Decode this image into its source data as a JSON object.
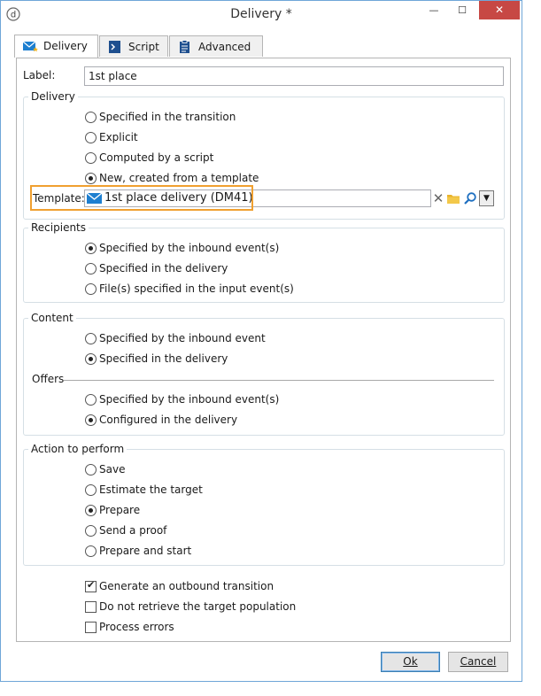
{
  "window": {
    "title": "Delivery *",
    "minimize": "—",
    "maximize": "☐",
    "close": "✕"
  },
  "tabs": [
    {
      "label": "Delivery",
      "icon": "envelope-star-icon"
    },
    {
      "label": "Script",
      "icon": "script-icon"
    },
    {
      "label": "Advanced",
      "icon": "clipboard-icon"
    }
  ],
  "label_field": {
    "label": "Label:",
    "value": "1st place"
  },
  "delivery_group": {
    "title": "Delivery",
    "options": [
      "Specified in the transition",
      "Explicit",
      "Computed by a script",
      "New, created from a template"
    ],
    "selected": 3
  },
  "template_field": {
    "label": "Template:",
    "value": "1st place delivery (DM41)",
    "icon": "envelope-icon"
  },
  "recipients_group": {
    "title": "Recipients",
    "options": [
      "Specified by the inbound event(s)",
      "Specified in the delivery",
      "File(s) specified in the input event(s)"
    ],
    "selected": 0
  },
  "content_group": {
    "title": "Content",
    "options": [
      "Specified by the inbound event",
      "Specified in the delivery"
    ],
    "selected": 1,
    "offers_title": "Offers",
    "offers_options": [
      "Specified by the inbound event(s)",
      "Configured in the delivery"
    ],
    "offers_selected": 1
  },
  "action_group": {
    "title": "Action to perform",
    "options": [
      "Save",
      "Estimate the target",
      "Prepare",
      "Send a proof",
      "Prepare and start"
    ],
    "selected": 2
  },
  "checkboxes": [
    {
      "label": "Generate an outbound transition",
      "checked": true
    },
    {
      "label": "Do not retrieve the target population",
      "checked": false
    },
    {
      "label": "Process errors",
      "checked": false
    }
  ],
  "buttons": {
    "ok": "Ok",
    "cancel": "Cancel"
  },
  "colors": {
    "highlight": "#f0a030",
    "close_button": "#c74844",
    "accent": "#1e7fd0"
  }
}
